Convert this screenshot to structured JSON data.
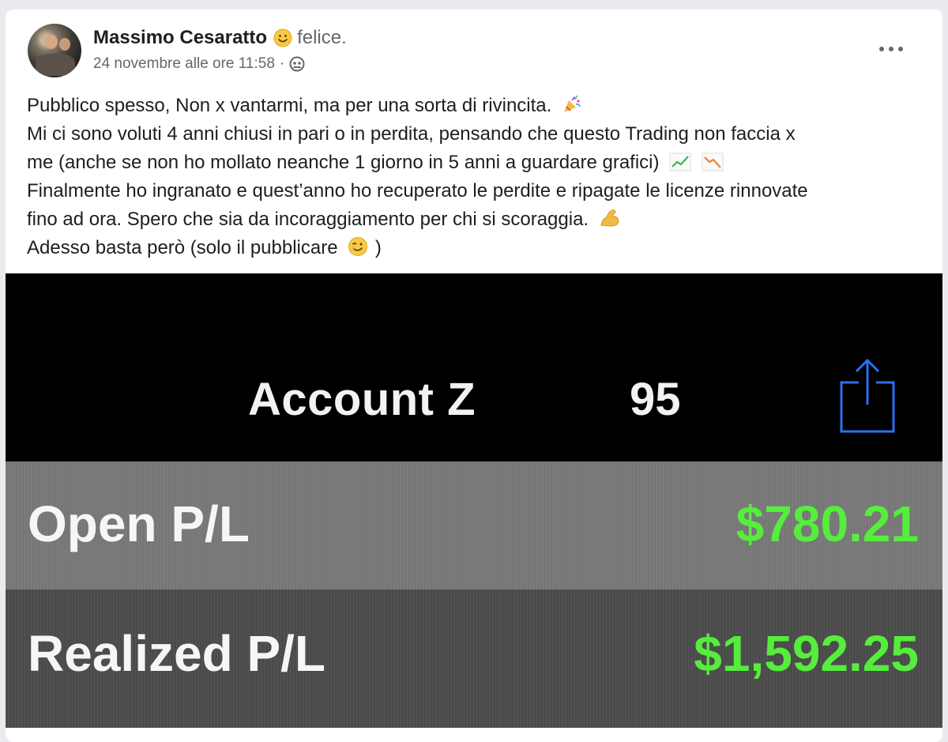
{
  "post": {
    "author": "Massimo Cesaratto",
    "feeling": "felice.",
    "timestamp": "24 novembre alle ore 11:58",
    "separator": "·",
    "privacy_icon": "friends-icon",
    "more_icon": "more-options-icon",
    "lines": [
      "Pubblico spesso, Non x vantarmi, ma per una sorta di rivincita.",
      "Mi ci sono voluti 4 anni chiusi in pari o in perdita, pensando che questo Trading non faccia x",
      "me (anche se non ho mollato neanche 1 giorno in 5 anni a guardare grafici)",
      "Finalmente ho ingranato e quest’anno ho recuperato le perdite e ripagate le licenze rinnovate",
      "fino ad ora. Spero che sia da incoraggiamento per chi si scoraggia.",
      "Adesso basta però (solo il pubblicare",
      ")"
    ]
  },
  "screenshot": {
    "account_prefix": "Account Z",
    "account_suffix": "95",
    "share_icon": "share-icon",
    "rows": [
      {
        "label": "Open P/L",
        "value": "$780.21"
      },
      {
        "label": "Realized P/L",
        "value": "$1,592.25"
      }
    ],
    "colors": {
      "value_green": "#55ee3c",
      "share_blue": "#2a6ff0"
    }
  }
}
